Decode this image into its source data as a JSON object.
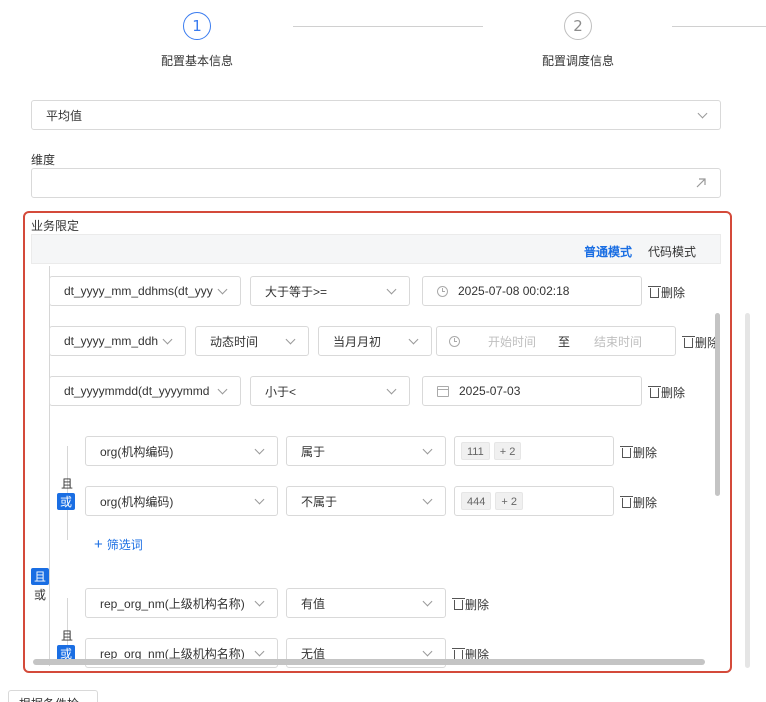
{
  "steps": [
    {
      "number": "1",
      "label": "配置基本信息"
    },
    {
      "number": "2",
      "label": "配置调度信息"
    }
  ],
  "aggregation": {
    "value": "平均值"
  },
  "dimension": {
    "label": "维度"
  },
  "business": {
    "label": "业务限定",
    "mode_normal": "普通模式",
    "mode_code": "代码模式",
    "delete_label": "删除",
    "range_sep": "至",
    "add_filter": "筛选词",
    "and_label": "且",
    "or_label": "或"
  },
  "conditions": {
    "c1": {
      "field": "dt_yyyy_mm_ddhms(dt_yyy",
      "op": "大于等于>=",
      "value": "2025-07-08 00:02:18"
    },
    "c2": {
      "field": "dt_yyyy_mm_ddh",
      "mode": "动态时间",
      "period": "当月月初",
      "start_ph": "开始时间",
      "end_ph": "结束时间"
    },
    "c3": {
      "field": "dt_yyyymmdd(dt_yyyymmd",
      "op": "小于<",
      "value": "2025-07-03"
    },
    "g1": {
      "field": "org(机构编码)",
      "op": "属于",
      "tag": "111",
      "more": "+ 2"
    },
    "g2": {
      "field": "org(机构编码)",
      "op": "不属于",
      "tag": "444",
      "more": "+ 2"
    },
    "h1": {
      "field": "rep_org_nm(上级机构名称)",
      "op": "有值"
    },
    "h2": {
      "field": "rep_org_nm(上级机构名称)",
      "op": "无值"
    }
  },
  "footer": {
    "button": "根据条件检验"
  }
}
